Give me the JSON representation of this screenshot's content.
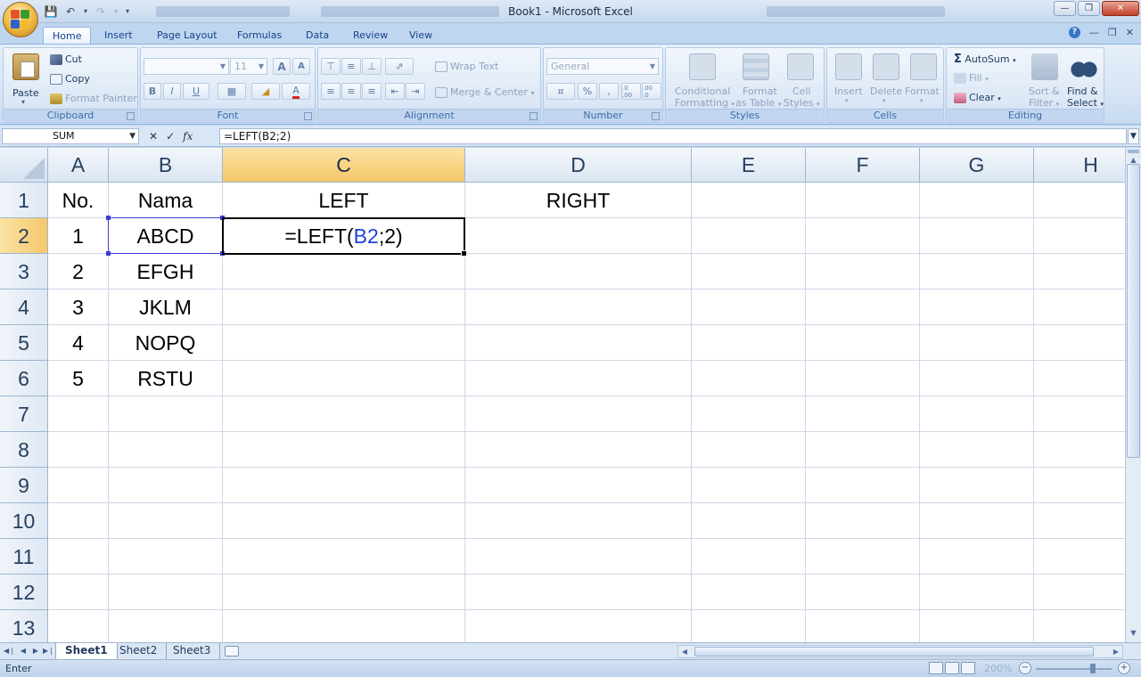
{
  "window": {
    "title": "Book1 - Microsoft Excel"
  },
  "ribbon_tabs": [
    "Home",
    "Insert",
    "Page Layout",
    "Formulas",
    "Data",
    "Review",
    "View"
  ],
  "clipboard": {
    "paste": "Paste",
    "cut": "Cut",
    "copy": "Copy",
    "format_painter": "Format Painter",
    "label": "Clipboard"
  },
  "font": {
    "size": "11",
    "bold": "B",
    "italic": "I",
    "underline": "U",
    "label": "Font",
    "grow": "A",
    "shrink": "A"
  },
  "alignment": {
    "wrap_text": "Wrap Text",
    "merge_center": "Merge & Center",
    "label": "Alignment"
  },
  "number": {
    "format": "General",
    "percent": "%",
    "comma": ",",
    "inc_dec": ".0 .00",
    "dec_dec": ".00 .0",
    "label": "Number"
  },
  "styles": {
    "conditional": "Conditional",
    "formatting": "Formatting",
    "format_as": "Format",
    "as_table": "as Table",
    "cell": "Cell",
    "cell_styles": "Styles",
    "label": "Styles"
  },
  "cells_group": {
    "insert": "Insert",
    "delete": "Delete",
    "format": "Format",
    "label": "Cells"
  },
  "editing": {
    "autosum": "AutoSum",
    "fill": "Fill",
    "clear": "Clear",
    "sort": "Sort &",
    "filter": "Filter",
    "find": "Find &",
    "select": "Select",
    "label": "Editing"
  },
  "formula_bar": {
    "name_box": "SUM",
    "formula": "=LEFT(B2;2)",
    "fx": "fx"
  },
  "columns": [
    "A",
    "B",
    "C",
    "D",
    "E",
    "F",
    "G",
    "H"
  ],
  "rows": [
    "1",
    "2",
    "3",
    "4",
    "5",
    "6",
    "7",
    "8",
    "9",
    "10",
    "11",
    "12",
    "13"
  ],
  "cells": {
    "A1": "No.",
    "B1": "Nama",
    "C1": "LEFT",
    "D1": "RIGHT",
    "A2": "1",
    "B2": "ABCD",
    "A3": "2",
    "B3": "EFGH",
    "A4": "3",
    "B4": "JKLM",
    "A5": "4",
    "B5": "NOPQ",
    "A6": "5",
    "B6": "RSTU",
    "C2_pre": "=LEFT(",
    "C2_ref": "B2",
    "C2_post": ";2)"
  },
  "sheets": [
    "Sheet1",
    "Sheet2",
    "Sheet3"
  ],
  "status": {
    "mode": "Enter",
    "zoom": "200%"
  },
  "colors": {
    "selected_header": "#f5c76a",
    "reference": "#1f3fdc",
    "ribbon": "#dbe7f5"
  },
  "icons": [
    "office-button-icon",
    "save-icon",
    "undo-icon",
    "redo-icon",
    "scissors-icon",
    "copy-icon",
    "paintbrush-icon",
    "sigma-icon",
    "binoculars-icon"
  ]
}
